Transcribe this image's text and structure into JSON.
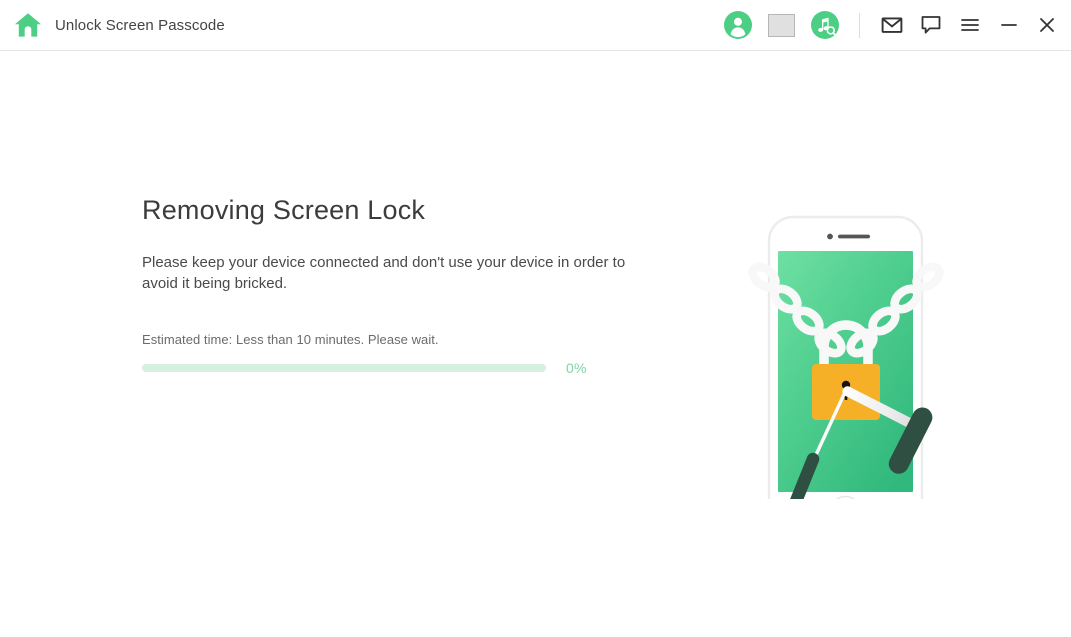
{
  "window": {
    "title": "Unlock Screen Passcode",
    "home_icon": "home-icon",
    "right_icons": [
      {
        "name": "account-avatar-icon",
        "glyph": "user"
      },
      {
        "name": "placeholder-square-icon",
        "glyph": "square"
      },
      {
        "name": "music-search-icon",
        "glyph": "music-magnifier"
      },
      {
        "name": "mail-icon",
        "glyph": "envelope"
      },
      {
        "name": "feedback-chat-icon",
        "glyph": "chat-bubble"
      },
      {
        "name": "menu-icon",
        "glyph": "hamburger"
      },
      {
        "name": "minimize-icon",
        "glyph": "minus"
      },
      {
        "name": "close-icon",
        "glyph": "x"
      }
    ]
  },
  "main": {
    "headline": "Removing Screen Lock",
    "description": "Please keep your device connected and don't use your device in order to avoid it being bricked.",
    "estimated_time": "Estimated time: Less than 10 minutes. Please wait.",
    "progress": {
      "percent_label": "0%",
      "percent_value": 0,
      "track_color": "#d6f0df",
      "fill_color": "#4ccf85",
      "label_color": "#7ed6a4"
    }
  },
  "illustration": {
    "name": "phone-lock-picking-illustration",
    "device_body_color": "#ffffff",
    "device_border_color": "#e9e9e9",
    "screen_gradient_start": "#6ee0a2",
    "screen_gradient_end": "#31b87c",
    "chain_color": "#f7f7f7",
    "padlock_color": "#f5b027",
    "tool_handle_color": "#2f4f42",
    "tool_shaft_color": "#f2f2f2"
  },
  "theme": {
    "brand_green": "#4ccf85",
    "title_text": "#444444",
    "body_text": "#4a4a4a",
    "muted_text": "#6b6b6b",
    "border": "#e4e4e4",
    "background": "#ffffff"
  }
}
